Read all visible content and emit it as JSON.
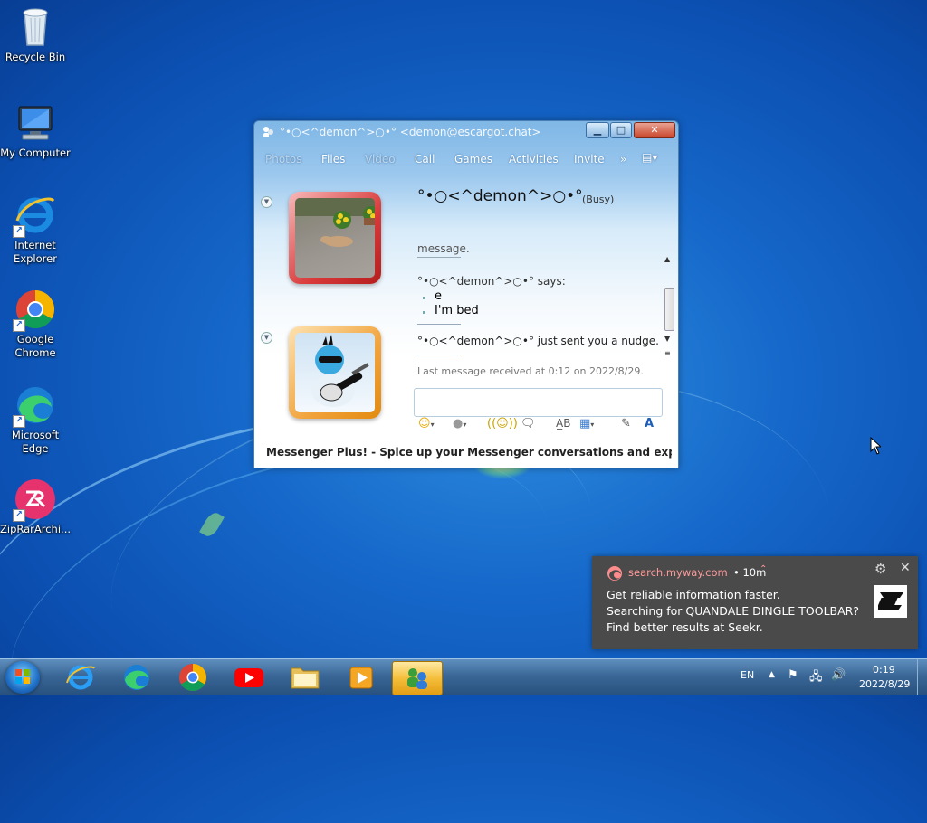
{
  "desktop": {
    "icons": [
      {
        "label": "Recycle Bin"
      },
      {
        "label": "My Computer"
      },
      {
        "label": "Internet Explorer"
      },
      {
        "label": "Google Chrome"
      },
      {
        "label": "Microsoft Edge"
      },
      {
        "label": "ZipRarArchi..."
      }
    ]
  },
  "messenger": {
    "title": "°•○<^demon^>○•° <demon@escargot.chat>",
    "menu": [
      "Photos",
      "Files",
      "Video",
      "Call",
      "Games",
      "Activities",
      "Invite",
      "»"
    ],
    "contact_name": "°•○<^demon^>○•°",
    "contact_status": "(Busy)",
    "conversation": {
      "cut_text": "message.",
      "sender_line": "°•○<^demon^>○•° says:",
      "messages": [
        "e",
        "I'm bed"
      ],
      "nudge": "°•○<^demon^>○•° just sent you a nudge."
    },
    "last_message": "Last message received at 0:12 on 2022/8/29.",
    "plus_bar": "Messenger Plus! - Spice up your Messenger conversations and experience wit..."
  },
  "notification": {
    "source": "search.myway.com",
    "time": "• 10m",
    "lines": [
      "Get reliable information faster.",
      "Searching for QUANDALE DINGLE TOOLBAR?",
      "Find better results at Seekr."
    ]
  },
  "taskbar": {
    "language": "EN",
    "time": "0:19",
    "date": "2022/8/29"
  }
}
